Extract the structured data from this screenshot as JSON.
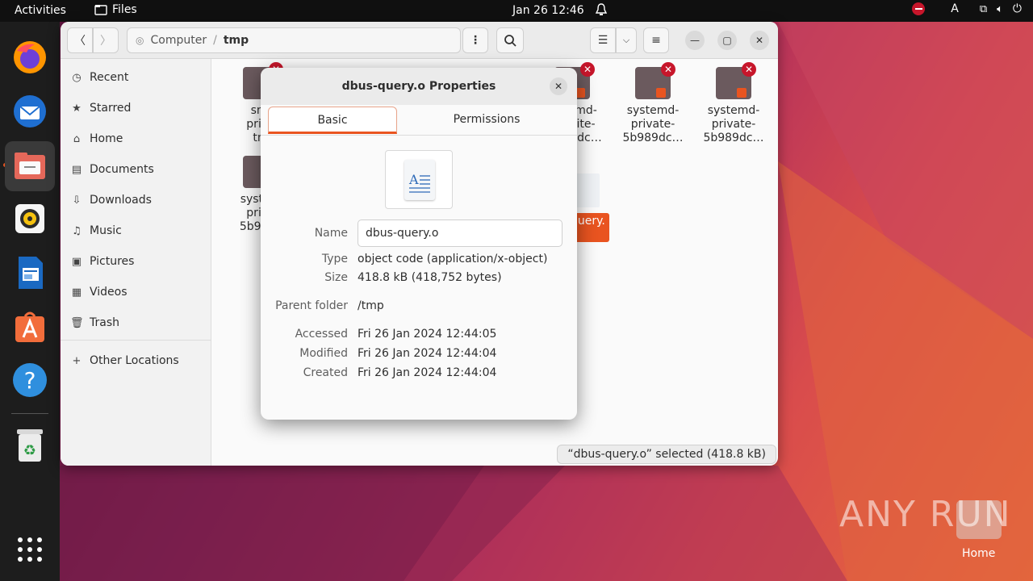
{
  "topbar": {
    "activities": "Activities",
    "app": "Files",
    "clock": "Jan 26  12:46",
    "keyboard": "A"
  },
  "headerbar": {
    "path_root": "Computer",
    "path_current": "tmp"
  },
  "sidebar": {
    "items": [
      {
        "label": "Recent",
        "icon": "clock-icon"
      },
      {
        "label": "Starred",
        "icon": "star-icon"
      },
      {
        "label": "Home",
        "icon": "home-icon"
      },
      {
        "label": "Documents",
        "icon": "document-icon"
      },
      {
        "label": "Downloads",
        "icon": "download-icon"
      },
      {
        "label": "Music",
        "icon": "music-icon"
      },
      {
        "label": "Pictures",
        "icon": "picture-icon"
      },
      {
        "label": "Videos",
        "icon": "video-icon"
      },
      {
        "label": "Trash",
        "icon": "trash-icon"
      },
      {
        "label": "Other Locations",
        "icon": "plus-icon"
      }
    ]
  },
  "files": [
    {
      "l1": "sna",
      "l2": "priva",
      "l3": "tm"
    },
    {
      "l1": "systemd-",
      "l2": "private-",
      "l3": "5b989dc…"
    },
    {
      "l1": "systemd-",
      "l2": "private-",
      "l3": "5b989dc…"
    },
    {
      "l1": "system",
      "l2": "priva",
      "l3": "5b989c"
    },
    {
      "l1": "md-",
      "l2": "ite-",
      "l3": "9dc…"
    },
    {
      "l1": "query."
    }
  ],
  "status": "“dbus-query.o” selected  (418.8 kB)",
  "dialog": {
    "title": "dbus-query.o Properties",
    "tabs": [
      "Basic",
      "Permissions"
    ],
    "name_label": "Name",
    "name_value": "dbus-query.o",
    "type_label": "Type",
    "type_value": "object code (application/x-object)",
    "size_label": "Size",
    "size_value": "418.8 kB (418,752 bytes)",
    "parent_label": "Parent folder",
    "parent_value": "/tmp",
    "accessed_label": "Accessed",
    "accessed_value": "Fri 26 Jan 2024 12:44:05",
    "modified_label": "Modified",
    "modified_value": "Fri 26 Jan 2024 12:44:04",
    "created_label": "Created",
    "created_value": "Fri 26 Jan 2024 12:44:04"
  },
  "desktop": {
    "home_label": "Home",
    "watermark": "ANY RUN"
  },
  "colors": {
    "accent": "#e95420",
    "topbar": "#101010",
    "dock": "#1d1d1d"
  }
}
